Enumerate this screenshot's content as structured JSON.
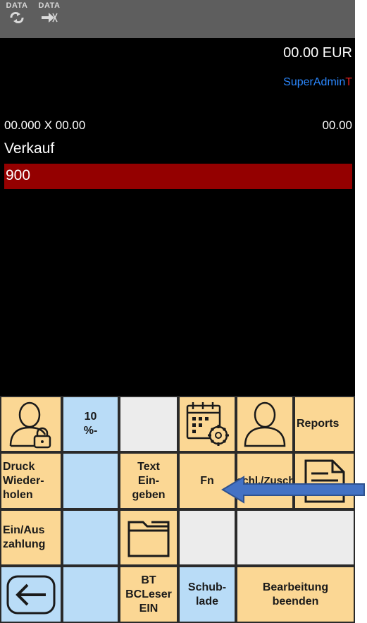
{
  "status_bar": {
    "data_sync_label": "DATA",
    "data_transfer_label": "DATA"
  },
  "display": {
    "total": "00.00 EUR",
    "user_blue": "SuperAdmin",
    "user_red": "T",
    "quantity_price": "00.000 X 00.00",
    "line_amount": "00.00",
    "mode": "Verkauf",
    "input_value": "900"
  },
  "keypad": {
    "discount_label_line1": "10",
    "discount_label_line2": "%-",
    "reports_label": "Reports",
    "reprint_label": [
      "Druck",
      "Wieder-",
      "holen"
    ],
    "text_entry_label": [
      "Text",
      "Ein-",
      "geben"
    ],
    "fn_label": "Fn",
    "reorder_label": "Nachl./Zuschl.",
    "cash_inout_label": [
      "Ein/Aus",
      "zahlung"
    ],
    "bt_reader_label": [
      "BT",
      "BCLeser",
      "EIN"
    ],
    "drawer_label": [
      "Schub-",
      "lade"
    ],
    "finish_label": [
      "Bearbeitung",
      "beenden"
    ]
  },
  "colors": {
    "key_orange": "#fbd794",
    "key_blue": "#b9dcf7",
    "input_bar": "#940000",
    "user_blue": "#2b88ff",
    "user_red": "#e32020",
    "annotation_arrow": "#4472c4"
  },
  "icons": {
    "user_locked": "user-lock-icon",
    "calendar_settings": "calendar-gear-icon",
    "user": "user-icon",
    "folder": "folder-icon",
    "back": "back-arrow-icon",
    "document": "document-icon",
    "annotation": "pointer-arrow-icon"
  }
}
